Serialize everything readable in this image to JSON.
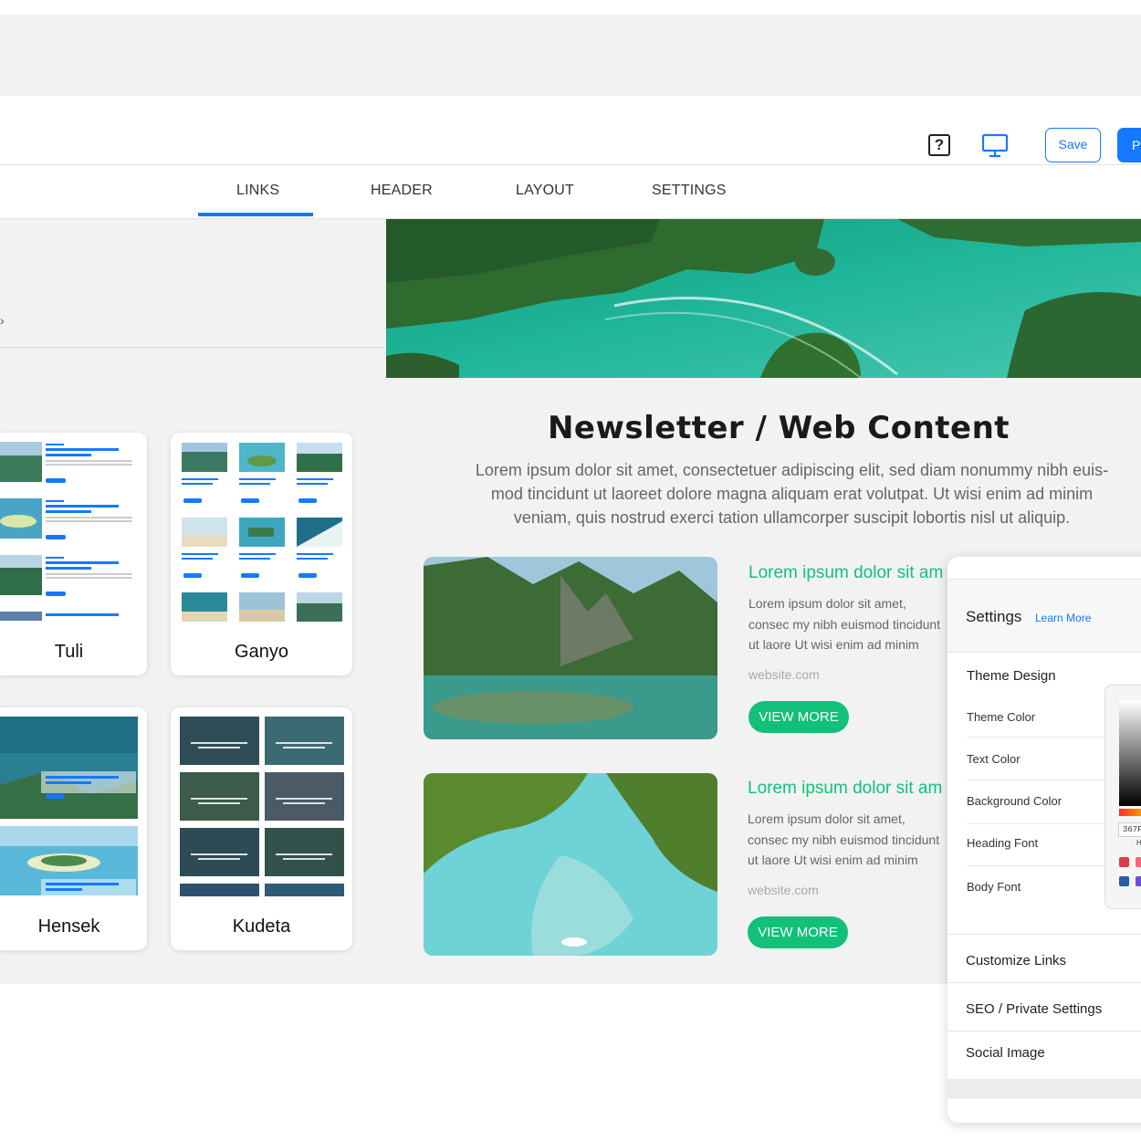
{
  "toolbar": {
    "help_glyph": "?",
    "save_label": "Save",
    "publish_label": "P"
  },
  "tabs": [
    "LINKS",
    "HEADER",
    "LAYOUT",
    "SETTINGS"
  ],
  "left": {
    "caret": "›",
    "templates": [
      {
        "name": "Tuli"
      },
      {
        "name": "Ganyo"
      },
      {
        "name": "Hensek"
      },
      {
        "name": "Kudeta"
      }
    ]
  },
  "preview": {
    "title": "Newsletter / Web Content",
    "body": "Lorem ipsum dolor sit amet, consectetuer adipiscing elit, sed diam nonummy nibh euis- mod tincidunt ut laoreet dolore magna aliquam erat volutpat. Ut wisi enim ad minim veniam, quis nostrud exerci tation ullamcorper suscipit lobortis nisl ut aliquip.",
    "articles": [
      {
        "heading": "Lorem ipsum dolor sit am",
        "body": "Lorem ipsum dolor sit amet, consec my nibh euismod tincidunt ut laore Ut wisi enim ad minim veniam.",
        "site": "website.com",
        "button": "VIEW MORE"
      },
      {
        "heading": "Lorem ipsum dolor sit am",
        "body": "Lorem ipsum dolor sit amet, consec my nibh euismod tincidunt ut laore Ut wisi enim ad minim veniam.",
        "site": "website.com",
        "button": "VIEW MORE"
      }
    ]
  },
  "settings": {
    "title": "Settings",
    "learn_more": "Learn More",
    "theme_design": "Theme Design",
    "theme_items": [
      "Theme Color",
      "Text Color",
      "Background Color",
      "Heading Font",
      "Body Font"
    ],
    "sections": [
      "Customize Links",
      "SEO / Private Settings",
      "Social Image"
    ],
    "hex_value": "367F",
    "hex_label": "H"
  },
  "colors": {
    "accent_blue": "#1479ff",
    "accent_green": "#12c07a"
  }
}
